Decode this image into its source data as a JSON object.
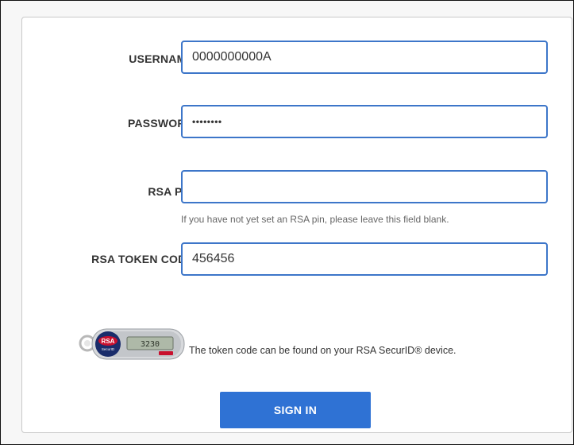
{
  "form": {
    "username_label": "USERNAME",
    "username_value": "0000000000A",
    "password_label": "PASSWORD",
    "password_dots": "••••••••",
    "rsa_pin_label": "RSA PIN",
    "rsa_pin_value": "",
    "rsa_pin_hint": "If you have not yet set an RSA pin, please leave this field blank.",
    "token_label": "RSA TOKEN CODE",
    "token_value": "456456",
    "token_note": "The token code can be found on your RSA SecurID® device.",
    "signin_label": "SIGN IN"
  },
  "device": {
    "brand": "RSA",
    "sub": "SecurID",
    "display": "3230"
  },
  "colors": {
    "accent": "#2f72d4",
    "field_border": "#3d76c9",
    "rsa_red": "#c8102e"
  }
}
